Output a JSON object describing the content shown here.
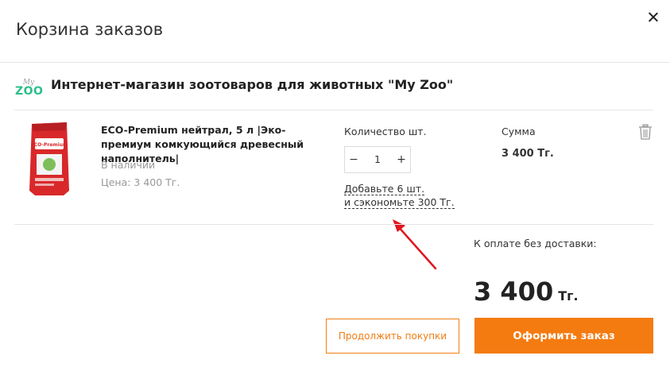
{
  "modal": {
    "title": "Корзина заказов"
  },
  "store": {
    "logo_text": "ZOO",
    "name": "Интернет-магазин зоотоваров для животных \"My Zoo\""
  },
  "product": {
    "title": "ECO-Premium нейтрал, 5 л |Эко-премиум комкующийся древесный наполнитель|",
    "stock": "В наличии",
    "price": "Цена: 3 400 Тг.",
    "image_text": "ECO-Premium"
  },
  "quantity": {
    "label": "Количество шт.",
    "value": "1",
    "minus": "−",
    "plus": "+",
    "promo_line1": "Добавьте 6 шт.",
    "promo_line2": "и сэкономьте 300 Тг."
  },
  "sum": {
    "label": "Сумма",
    "value": "3 400 Тг."
  },
  "total": {
    "label": "К оплате без доставки:",
    "amount": "3 400",
    "currency": "Тг."
  },
  "buttons": {
    "continue": "Продолжить покупки",
    "order": "Оформить заказ"
  },
  "colors": {
    "accent": "#f47b10",
    "logo_green": "#2bbf8a",
    "arrow_red": "#e0141e"
  }
}
